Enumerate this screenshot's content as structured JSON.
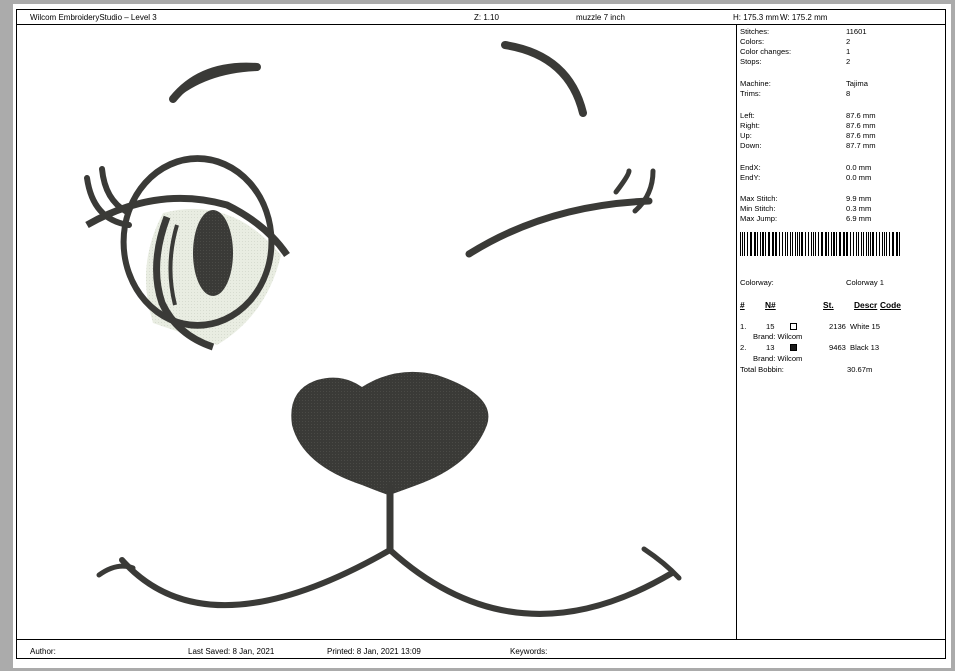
{
  "header": {
    "app_title": "Wilcom EmbroideryStudio – Level 3",
    "zoom": "Z: 1.10",
    "design_name": "muzzle 7 inch",
    "height": "H: 175.3 mm",
    "width": "W: 175.2 mm"
  },
  "stats": [
    {
      "label": "Stitches:",
      "value": "11601"
    },
    {
      "label": "Colors:",
      "value": "2"
    },
    {
      "label": "Color changes:",
      "value": "1"
    },
    {
      "label": "Stops:",
      "value": "2"
    },
    {
      "label": "Machine:",
      "value": "Tajima"
    },
    {
      "label": "Trims:",
      "value": "8"
    },
    {
      "label": "Left:",
      "value": "87.6 mm"
    },
    {
      "label": "Right:",
      "value": "87.6 mm"
    },
    {
      "label": "Up:",
      "value": "87.6 mm"
    },
    {
      "label": "Down:",
      "value": "87.7 mm"
    },
    {
      "label": "EndX:",
      "value": "0.0 mm"
    },
    {
      "label": "EndY:",
      "value": "0.0 mm"
    },
    {
      "label": "Max Stitch:",
      "value": "9.9 mm"
    },
    {
      "label": "Min Stitch:",
      "value": "0.3 mm"
    },
    {
      "label": "Max Jump:",
      "value": "6.9 mm"
    }
  ],
  "colorway": {
    "label": "Colorway:",
    "value": "Colorway 1"
  },
  "color_table": {
    "headers": {
      "num": "#",
      "n": "N#",
      "st": "St.",
      "descr": "Descr",
      "code": "Code"
    },
    "rows": [
      {
        "num": "1.",
        "n": "15",
        "swatch": "#ffffff",
        "st": "2136",
        "descr": "White 15",
        "brand": "Brand: Wilcom"
      },
      {
        "num": "2.",
        "n": "13",
        "swatch": "#1a1a1a",
        "st": "9463",
        "descr": "Black 13",
        "brand": "Brand: Wilcom"
      }
    ],
    "bobbin_label": "Total Bobbin:",
    "bobbin_value": "30.67m"
  },
  "footer": {
    "author": "Author:",
    "last_saved": "Last Saved:  8 Jan, 2021",
    "printed": "Printed:  8 Jan, 2021 13:09",
    "keywords": "Keywords:"
  },
  "colors": {
    "thread_dark": "#3a3a37",
    "thread_light": "#e9ede2",
    "background": "#ababab"
  }
}
